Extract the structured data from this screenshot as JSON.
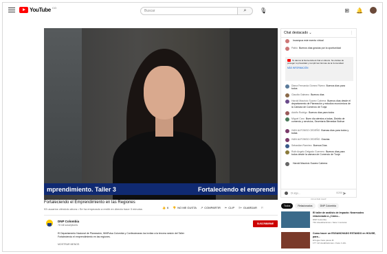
{
  "header": {
    "logo_text": "YouTube",
    "country": "CO",
    "search_placeholder": "Buscar",
    "search_icon": "search-icon",
    "mic_icon": "mic-icon"
  },
  "video": {
    "lower_third_left": "mprendimiento. Taller 3",
    "lower_third_right": "Fortaleciendo el emprendi",
    "title": "Fortaleciendo el Emprendimiento en las Regiones",
    "meta": "93 usuarios viéndolo ahora • Se ha empezado a emitir en directo hace 3 minutos",
    "actions": [
      "6",
      "NO ME GUSTA",
      "COMPARTIR",
      "CLIP",
      "GUARDAR"
    ]
  },
  "channel": {
    "name": "DNP Colombia",
    "subs": "78 mil suscriptores",
    "subscribe": "SUSCRIBIRME",
    "description": "El Departamento Nacional de Planeación, INNPulsa Colombia y Confecámaras los invitan a la tercera sesión del Taller Fortaleciendo el emprendimiento en las regiones.",
    "more": "MOSTRAR MENOS"
  },
  "chat": {
    "header": "Chat destacado",
    "messages_top": [
      {
        "author": "",
        "text": "Incampus este evento virtual"
      },
      {
        "author": "Pablo",
        "text": "Buenos días gracias por la oportunidad"
      }
    ],
    "notice_text": "Te damos la bienvenida al chat en directo. No olvides de proteger tu privacidad y cumplir las Normas de la Comunidad.",
    "notice_link": "MÁS INFORMACIÓN",
    "messages": [
      {
        "author": "Diana Fernanda Gómez Rivera",
        "text": "Buenos días para todos"
      },
      {
        "author": "Claudia Galeano",
        "text": "Buenos días"
      },
      {
        "author": "Harold Mauricio Suarez Cabrera",
        "text": "Buenos días desde el departamento de Planeación y estudios económicos de la Cámara de Comercio de Tunja"
      },
      {
        "author": "Adolfo Rodrigo",
        "text": "Buenos días para todos"
      },
      {
        "author": "Miguel Caro",
        "text": "Buen día atentos a todas, Distrito de comercio y servicios, Secretaría Bienestar Bolívar"
      },
      {
        "author": "IVAN ALFONSO CEDEÑO",
        "text": "Buenas días para todos y todas"
      },
      {
        "author": "IVAN ALFONSO CEDEÑO",
        "text": "Gracias"
      },
      {
        "author": "Sebastian Ramirez",
        "text": "Buenos Días"
      },
      {
        "author": "Ruth Angelo Delgado Guerrero",
        "text": "Buenos días para todos desde la cámara de Comercio de Tunja"
      },
      {
        "author": "",
        "text": "Harold Mauricio Suarez Cabrera"
      }
    ],
    "input_placeholder": "Di algo...",
    "counter": "0/200",
    "footer": "OCULTAR CHAT"
  },
  "chips": [
    "Todos",
    "Relacionados",
    "DNP Colombia"
  ],
  "recommendations": [
    {
      "title": "El taller de análisis de Impacto: Nearmodeo relacionado a ¿Cómo...",
      "channel": "DNP Colombia",
      "meta": "734 visualizaciones • hace 1 semana",
      "thumb": "#3a6a8a"
    },
    {
      "title": "Como hacer un ESGANCHADO ESTANDO en HOUSE, para...",
      "channel": "El legue hace pasos ⊗",
      "meta": "177 mil visualizaciones • hace 1 año",
      "thumb": "#7a3a2a"
    }
  ]
}
